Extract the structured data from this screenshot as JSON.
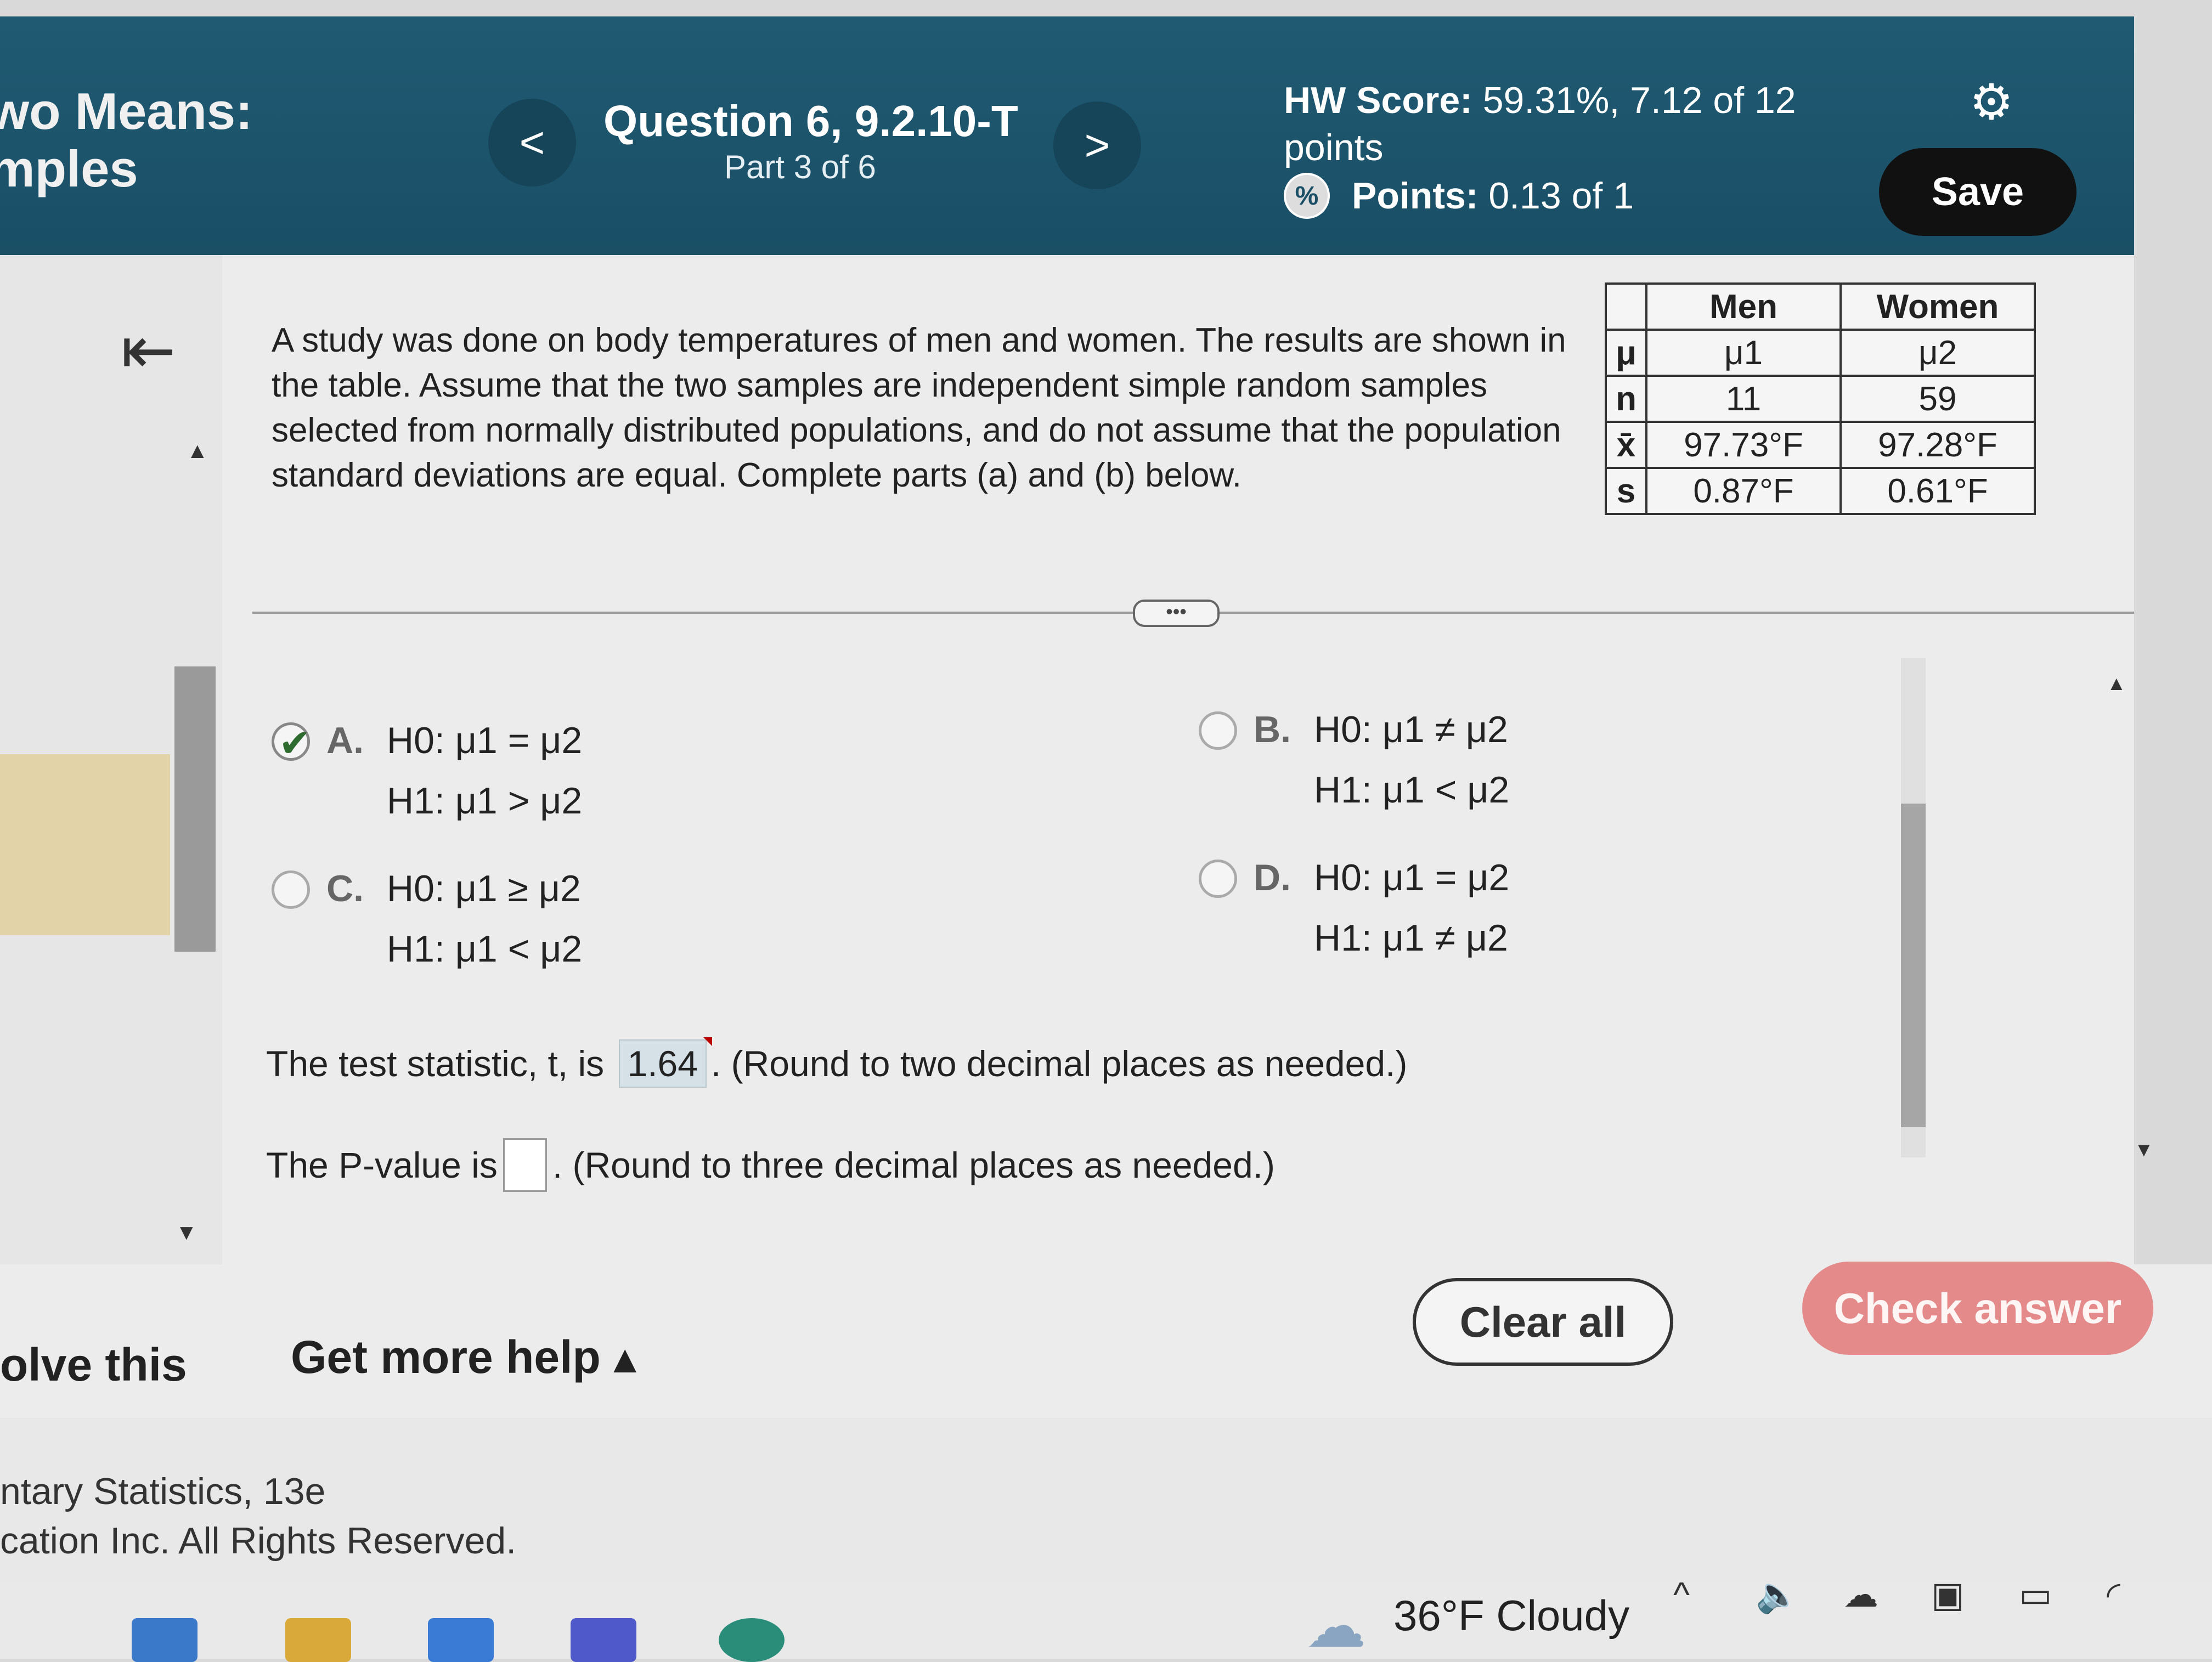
{
  "header": {
    "course_title": "wo Means:\nmples",
    "question_title": "Question 6, 9.2.10-T",
    "question_part": "Part 3 of 6",
    "hw_score_label": "HW Score:",
    "hw_score_value": "59.31%, 7.12 of 12 points",
    "points_label": "Points:",
    "points_value": "0.13 of 1",
    "save_label": "Save",
    "prev_symbol": "<",
    "next_symbol": ">"
  },
  "problem": {
    "text": "A study was done on body temperatures of men and women. The results are shown in the table. Assume that the two samples are independent simple random samples selected from normally distributed populations, and do not assume that the population standard deviations are equal. Complete parts (a) and (b) below."
  },
  "table": {
    "headers": [
      "",
      "Men",
      "Women"
    ],
    "rows": [
      {
        "label": "μ",
        "men": "μ1",
        "women": "μ2"
      },
      {
        "label": "n",
        "men": "11",
        "women": "59"
      },
      {
        "label": "x̄",
        "men": "97.73°F",
        "women": "97.28°F"
      },
      {
        "label": "s",
        "men": "0.87°F",
        "women": "0.61°F"
      }
    ]
  },
  "options": {
    "a": {
      "letter": "A.",
      "h0": "H0: μ1 = μ2",
      "h1": "H1: μ1 > μ2",
      "selected": true
    },
    "b": {
      "letter": "B.",
      "h0": "H0: μ1 ≠ μ2",
      "h1": "H1: μ1 < μ2",
      "selected": false
    },
    "c": {
      "letter": "C.",
      "h0": "H0: μ1 ≥ μ2",
      "h1": "H1: μ1 < μ2",
      "selected": false
    },
    "d": {
      "letter": "D.",
      "h0": "H0: μ1 = μ2",
      "h1": "H1: μ1 ≠ μ2",
      "selected": false
    }
  },
  "answers": {
    "test_stat_prefix": "The test statistic, t, is",
    "test_stat_value": "1.64",
    "test_stat_suffix": ". (Round to two decimal places as needed.)",
    "p_value_prefix": "The P-value is",
    "p_value_value": "",
    "p_value_suffix": ". (Round to three decimal places as needed.)"
  },
  "actions": {
    "solve_label": "olve this",
    "help_label": "Get more help ▴",
    "clear_label": "Clear all",
    "check_label": "Check answer"
  },
  "footer": {
    "line1": "ntary Statistics, 13e",
    "line2": "cation Inc. All Rights Reserved."
  },
  "taskbar": {
    "weather": "36°F  Cloudy"
  }
}
